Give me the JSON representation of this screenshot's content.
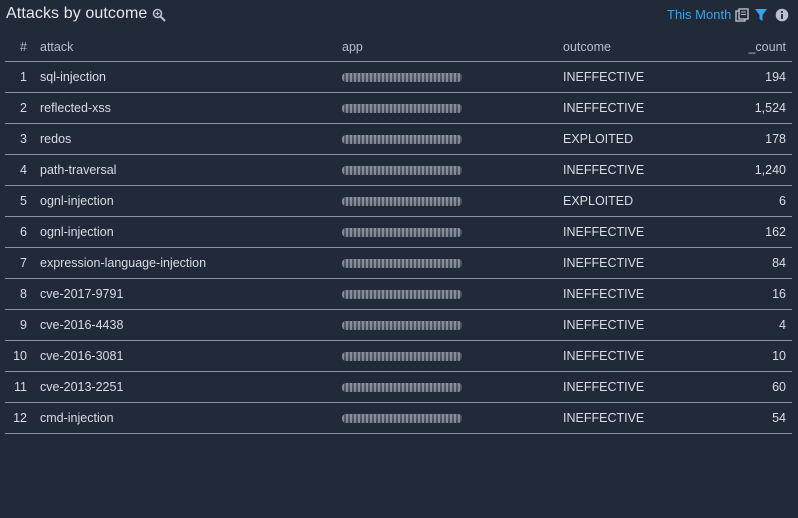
{
  "header": {
    "title": "Attacks by outcome",
    "time_range": "This Month",
    "icons": [
      "zoom-icon",
      "copy-icon",
      "filter-icon",
      "info-icon"
    ],
    "accent_color": "#3ba1ea"
  },
  "table": {
    "columns": [
      "#",
      "attack",
      "app",
      "outcome",
      "_count"
    ],
    "rows": [
      {
        "num": "1",
        "attack": "sql-injection",
        "app": "",
        "outcome": "INEFFECTIVE",
        "count": "194"
      },
      {
        "num": "2",
        "attack": "reflected-xss",
        "app": "",
        "outcome": "INEFFECTIVE",
        "count": "1,524"
      },
      {
        "num": "3",
        "attack": "redos",
        "app": "",
        "outcome": "EXPLOITED",
        "count": "178"
      },
      {
        "num": "4",
        "attack": "path-traversal",
        "app": "",
        "outcome": "INEFFECTIVE",
        "count": "1,240"
      },
      {
        "num": "5",
        "attack": "ognl-injection",
        "app": "",
        "outcome": "EXPLOITED",
        "count": "6"
      },
      {
        "num": "6",
        "attack": "ognl-injection",
        "app": "",
        "outcome": "INEFFECTIVE",
        "count": "162"
      },
      {
        "num": "7",
        "attack": "expression-language-injection",
        "app": "",
        "outcome": "INEFFECTIVE",
        "count": "84"
      },
      {
        "num": "8",
        "attack": "cve-2017-9791",
        "app": "",
        "outcome": "INEFFECTIVE",
        "count": "16"
      },
      {
        "num": "9",
        "attack": "cve-2016-4438",
        "app": "",
        "outcome": "INEFFECTIVE",
        "count": "4"
      },
      {
        "num": "10",
        "attack": "cve-2016-3081",
        "app": "",
        "outcome": "INEFFECTIVE",
        "count": "10"
      },
      {
        "num": "11",
        "attack": "cve-2013-2251",
        "app": "",
        "outcome": "INEFFECTIVE",
        "count": "60"
      },
      {
        "num": "12",
        "attack": "cmd-injection",
        "app": "",
        "outcome": "INEFFECTIVE",
        "count": "54"
      }
    ]
  }
}
